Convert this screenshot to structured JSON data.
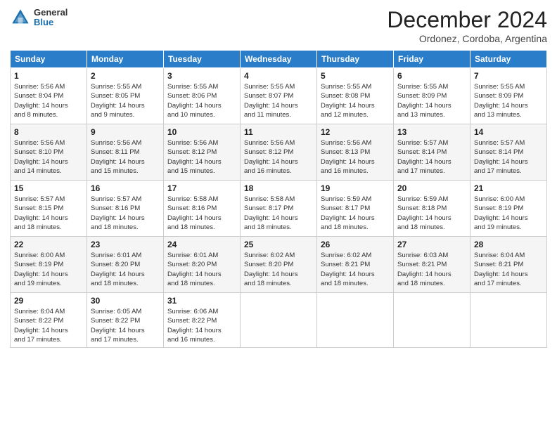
{
  "header": {
    "logo_general": "General",
    "logo_blue": "Blue",
    "month_title": "December 2024",
    "location": "Ordonez, Cordoba, Argentina"
  },
  "days_of_week": [
    "Sunday",
    "Monday",
    "Tuesday",
    "Wednesday",
    "Thursday",
    "Friday",
    "Saturday"
  ],
  "weeks": [
    [
      {
        "day": "1",
        "sunrise": "5:56 AM",
        "sunset": "8:04 PM",
        "daylight": "14 hours and 8 minutes."
      },
      {
        "day": "2",
        "sunrise": "5:55 AM",
        "sunset": "8:05 PM",
        "daylight": "14 hours and 9 minutes."
      },
      {
        "day": "3",
        "sunrise": "5:55 AM",
        "sunset": "8:06 PM",
        "daylight": "14 hours and 10 minutes."
      },
      {
        "day": "4",
        "sunrise": "5:55 AM",
        "sunset": "8:07 PM",
        "daylight": "14 hours and 11 minutes."
      },
      {
        "day": "5",
        "sunrise": "5:55 AM",
        "sunset": "8:08 PM",
        "daylight": "14 hours and 12 minutes."
      },
      {
        "day": "6",
        "sunrise": "5:55 AM",
        "sunset": "8:09 PM",
        "daylight": "14 hours and 13 minutes."
      },
      {
        "day": "7",
        "sunrise": "5:55 AM",
        "sunset": "8:09 PM",
        "daylight": "14 hours and 13 minutes."
      }
    ],
    [
      {
        "day": "8",
        "sunrise": "5:56 AM",
        "sunset": "8:10 PM",
        "daylight": "14 hours and 14 minutes."
      },
      {
        "day": "9",
        "sunrise": "5:56 AM",
        "sunset": "8:11 PM",
        "daylight": "14 hours and 15 minutes."
      },
      {
        "day": "10",
        "sunrise": "5:56 AM",
        "sunset": "8:12 PM",
        "daylight": "14 hours and 15 minutes."
      },
      {
        "day": "11",
        "sunrise": "5:56 AM",
        "sunset": "8:12 PM",
        "daylight": "14 hours and 16 minutes."
      },
      {
        "day": "12",
        "sunrise": "5:56 AM",
        "sunset": "8:13 PM",
        "daylight": "14 hours and 16 minutes."
      },
      {
        "day": "13",
        "sunrise": "5:57 AM",
        "sunset": "8:14 PM",
        "daylight": "14 hours and 17 minutes."
      },
      {
        "day": "14",
        "sunrise": "5:57 AM",
        "sunset": "8:14 PM",
        "daylight": "14 hours and 17 minutes."
      }
    ],
    [
      {
        "day": "15",
        "sunrise": "5:57 AM",
        "sunset": "8:15 PM",
        "daylight": "14 hours and 18 minutes."
      },
      {
        "day": "16",
        "sunrise": "5:57 AM",
        "sunset": "8:16 PM",
        "daylight": "14 hours and 18 minutes."
      },
      {
        "day": "17",
        "sunrise": "5:58 AM",
        "sunset": "8:16 PM",
        "daylight": "14 hours and 18 minutes."
      },
      {
        "day": "18",
        "sunrise": "5:58 AM",
        "sunset": "8:17 PM",
        "daylight": "14 hours and 18 minutes."
      },
      {
        "day": "19",
        "sunrise": "5:59 AM",
        "sunset": "8:17 PM",
        "daylight": "14 hours and 18 minutes."
      },
      {
        "day": "20",
        "sunrise": "5:59 AM",
        "sunset": "8:18 PM",
        "daylight": "14 hours and 18 minutes."
      },
      {
        "day": "21",
        "sunrise": "6:00 AM",
        "sunset": "8:19 PM",
        "daylight": "14 hours and 19 minutes."
      }
    ],
    [
      {
        "day": "22",
        "sunrise": "6:00 AM",
        "sunset": "8:19 PM",
        "daylight": "14 hours and 19 minutes."
      },
      {
        "day": "23",
        "sunrise": "6:01 AM",
        "sunset": "8:20 PM",
        "daylight": "14 hours and 18 minutes."
      },
      {
        "day": "24",
        "sunrise": "6:01 AM",
        "sunset": "8:20 PM",
        "daylight": "14 hours and 18 minutes."
      },
      {
        "day": "25",
        "sunrise": "6:02 AM",
        "sunset": "8:20 PM",
        "daylight": "14 hours and 18 minutes."
      },
      {
        "day": "26",
        "sunrise": "6:02 AM",
        "sunset": "8:21 PM",
        "daylight": "14 hours and 18 minutes."
      },
      {
        "day": "27",
        "sunrise": "6:03 AM",
        "sunset": "8:21 PM",
        "daylight": "14 hours and 18 minutes."
      },
      {
        "day": "28",
        "sunrise": "6:04 AM",
        "sunset": "8:21 PM",
        "daylight": "14 hours and 17 minutes."
      }
    ],
    [
      {
        "day": "29",
        "sunrise": "6:04 AM",
        "sunset": "8:22 PM",
        "daylight": "14 hours and 17 minutes."
      },
      {
        "day": "30",
        "sunrise": "6:05 AM",
        "sunset": "8:22 PM",
        "daylight": "14 hours and 17 minutes."
      },
      {
        "day": "31",
        "sunrise": "6:06 AM",
        "sunset": "8:22 PM",
        "daylight": "14 hours and 16 minutes."
      },
      null,
      null,
      null,
      null
    ]
  ],
  "labels": {
    "sunrise": "Sunrise:",
    "sunset": "Sunset:",
    "daylight": "Daylight:"
  }
}
